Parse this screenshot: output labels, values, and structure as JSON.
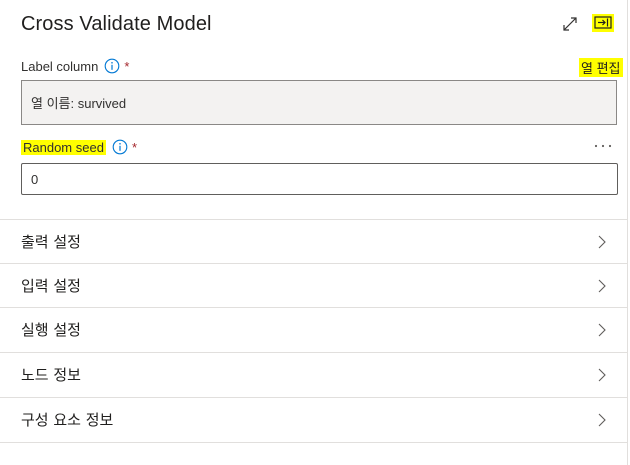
{
  "panel": {
    "title": "Cross Validate Model"
  },
  "label_column": {
    "label": "Label column",
    "required_mark": "*",
    "edit_link": "열 편집",
    "value": "열 이름: survived"
  },
  "random_seed": {
    "label": "Random seed",
    "required_mark": "*",
    "value": "0"
  },
  "sections": [
    {
      "label": "출력 설정"
    },
    {
      "label": "입력 설정"
    },
    {
      "label": "실행 설정"
    },
    {
      "label": "노드 정보"
    },
    {
      "label": "구성 요소 정보"
    }
  ],
  "colors": {
    "highlight": "#ffff00",
    "info_icon": "#0078d4",
    "required": "#a4262c"
  },
  "icons": [
    "expand-icon",
    "collapse-panel-icon",
    "info-icon",
    "more-options-icon",
    "chevron-right-icon"
  ]
}
